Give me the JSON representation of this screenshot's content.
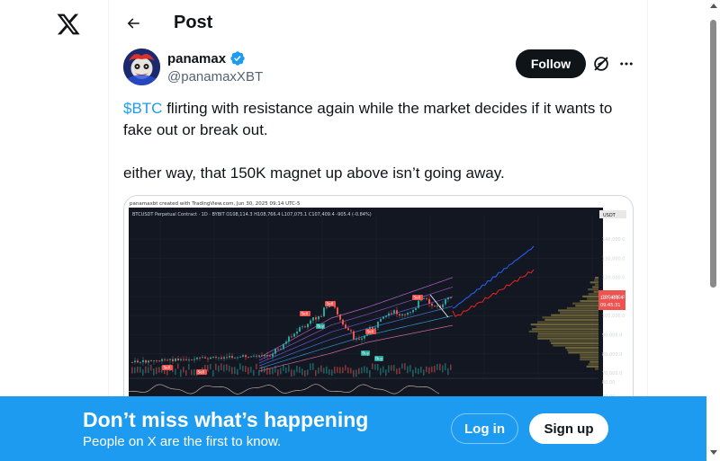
{
  "header": {
    "title": "Post"
  },
  "author": {
    "name": "panamax",
    "handle": "@panamaxXBT"
  },
  "actions": {
    "follow_label": "Follow"
  },
  "post": {
    "cashtag": "$BTC",
    "line1_rest": " flirting with resistance again while the market decides if it wants to fake out or break out.",
    "line2": "either way, that 150K magnet up above isn’t going away."
  },
  "chart_image": {
    "credit": "panamaxbt created with TradingView.com, Jun 30, 2025 09:14 UTC-5",
    "symbol_line": "BTCUSDT Perpetual Contract · 1D · BYBIT  O108,114.3  H108,766.4  L107,075.1  C107,409.4  -905.4 (-0.84%)",
    "currency": "USDT",
    "price_ticks": [
      "140,000.0",
      "130,000.0",
      "120,000.0",
      "110,000.0",
      "100,000.0",
      "90,000.0",
      "80,000.0",
      "70,000.0"
    ],
    "price_label": "107,409.4",
    "price_timer": "09:45:31",
    "indicator_ticks": [
      "80.00",
      "40.00"
    ],
    "sell_tags": [
      "Sell",
      "Sell",
      "Sell",
      "Sell",
      "Sell",
      "Sell"
    ],
    "buy_tags": [
      "Buy",
      "Buy",
      "Buy"
    ]
  },
  "banner": {
    "title": "Don’t miss what’s happening",
    "subtitle": "People on X are the first to know.",
    "login_label": "Log in",
    "signup_label": "Sign up"
  },
  "colors": {
    "accent": "#1d9bf0",
    "text": "#0f1419",
    "muted": "#536471",
    "chart_bg": "#131722",
    "bull": "#26a69a",
    "bear": "#ef5350"
  },
  "icons": [
    "x-logo-icon",
    "back-arrow-icon",
    "verified-badge-icon",
    "grok-icon",
    "more-icon"
  ]
}
